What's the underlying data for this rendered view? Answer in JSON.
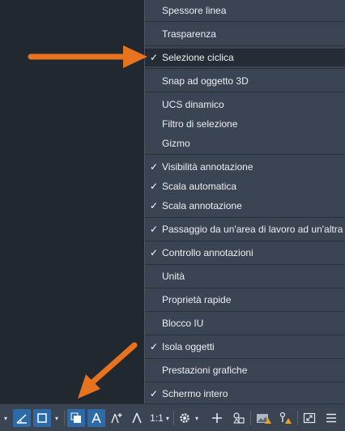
{
  "menu": {
    "items": [
      {
        "label": "Spessore linea",
        "checked": false,
        "highlighted": false
      },
      {
        "label": "Trasparenza",
        "checked": false,
        "highlighted": false
      },
      {
        "label": "Selezione ciclica",
        "checked": true,
        "highlighted": true
      },
      {
        "label": "Snap ad oggetto 3D",
        "checked": false,
        "highlighted": false
      },
      {
        "label": "UCS dinamico",
        "checked": false,
        "highlighted": false
      },
      {
        "label": "Filtro di selezione",
        "checked": false,
        "highlighted": false
      },
      {
        "label": "Gizmo",
        "checked": false,
        "highlighted": false
      },
      {
        "label": "Visibilità annotazione",
        "checked": true,
        "highlighted": false
      },
      {
        "label": "Scala automatica",
        "checked": true,
        "highlighted": false
      },
      {
        "label": "Scala annotazione",
        "checked": true,
        "highlighted": false
      },
      {
        "label": "Passaggio da un'area di lavoro ad un'altra",
        "checked": true,
        "highlighted": false
      },
      {
        "label": "Controllo annotazioni",
        "checked": true,
        "highlighted": false
      },
      {
        "label": "Unità",
        "checked": false,
        "highlighted": false
      },
      {
        "label": "Proprietà rapide",
        "checked": false,
        "highlighted": false
      },
      {
        "label": "Blocco IU",
        "checked": false,
        "highlighted": false
      },
      {
        "label": "Isola oggetti",
        "checked": true,
        "highlighted": false
      },
      {
        "label": "Prestazioni grafiche",
        "checked": false,
        "highlighted": false
      },
      {
        "label": "Schermo intero",
        "checked": true,
        "highlighted": false
      }
    ],
    "check_glyph": "✓"
  },
  "statusbar": {
    "scale_label": "1:1",
    "dropdown_glyph": "▾"
  },
  "colors": {
    "menu_bg": "#3b4453",
    "menu_highlight": "#252c35",
    "workspace_bg": "#212830",
    "arrow": "#e8731f",
    "active_button": "#2d6ba8"
  },
  "icons": [
    "polar-tracking-icon",
    "isodraft-icon",
    "selection-cycling-icon",
    "annotation-visibility-icon",
    "auto-scale-icon",
    "annotation-scale-icon",
    "gear-icon",
    "plus-icon",
    "units-icon",
    "quick-properties-icon",
    "lock-ui-icon",
    "fullscreen-icon",
    "hamburger-menu-icon"
  ]
}
